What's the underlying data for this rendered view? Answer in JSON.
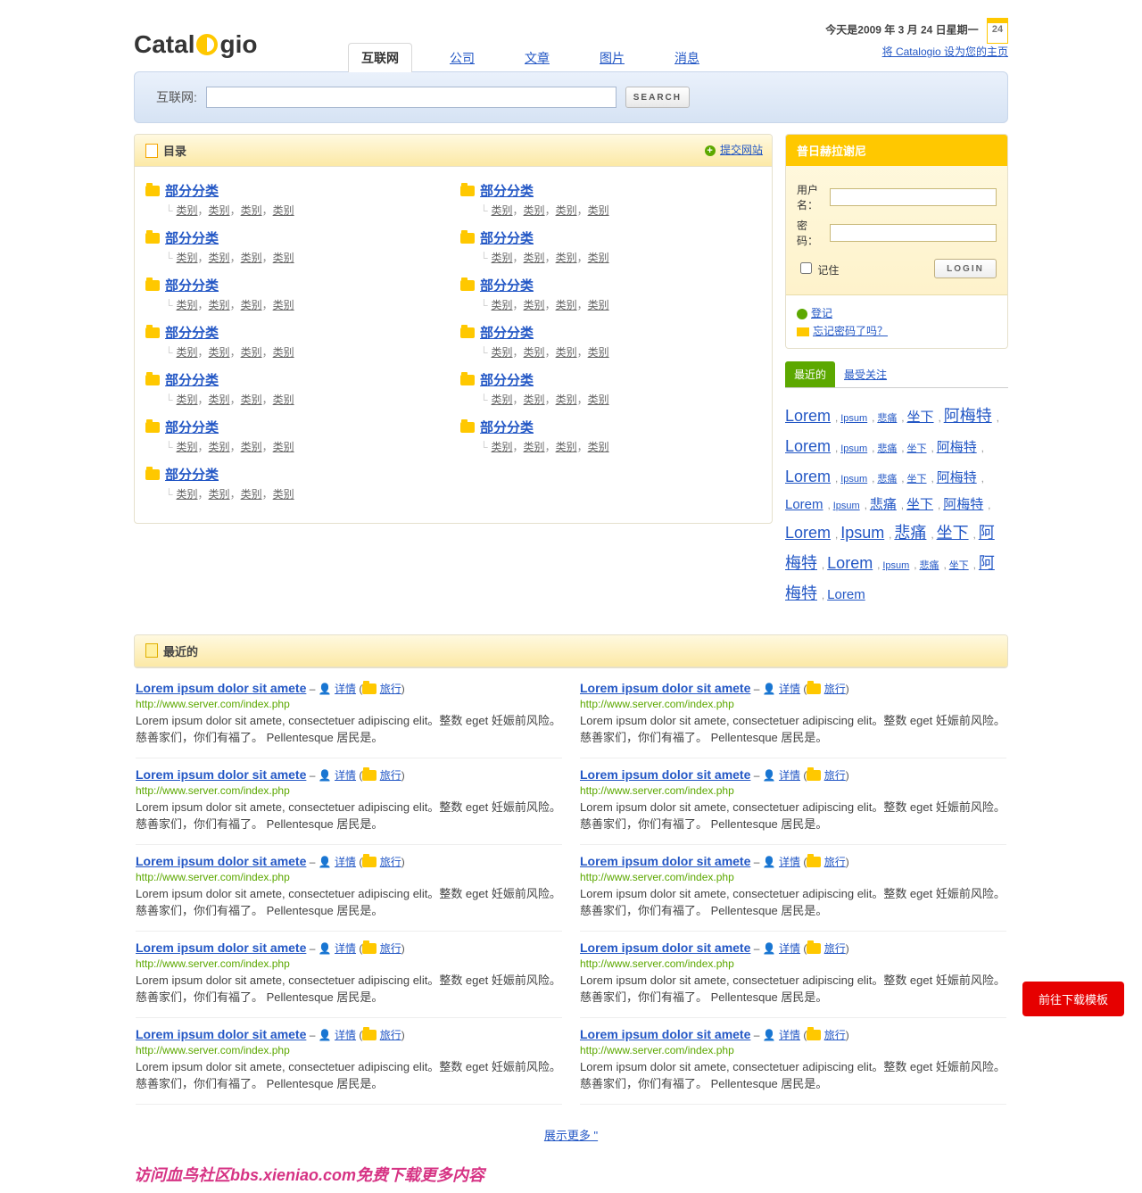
{
  "logo": {
    "pre": "Catal",
    "post": "gio"
  },
  "header": {
    "date": "今天是2009 年 3 月 24 日星期一",
    "homepage_link": "将 Catalogio 设为您的主页",
    "cal_day": "24"
  },
  "nav": [
    {
      "label": "互联网",
      "active": true
    },
    {
      "label": "公司",
      "active": false
    },
    {
      "label": "文章",
      "active": false
    },
    {
      "label": "图片",
      "active": false
    },
    {
      "label": "消息",
      "active": false
    }
  ],
  "search": {
    "label": "互联网:",
    "button": "SEARCH"
  },
  "catalog": {
    "title": "目录",
    "submit_link": "提交网站",
    "section": "部分分类",
    "sub": "类别",
    "left": [
      4,
      4,
      4,
      4,
      4,
      4,
      4
    ],
    "right": [
      4,
      4,
      4,
      4,
      4,
      4
    ]
  },
  "login": {
    "title": "普日赫拉谢尼",
    "username_label": "用户名：",
    "password_label": "密码：",
    "remember_label": "记住",
    "login_btn": "LOGIN",
    "register_link": "登记",
    "forgot_link": "忘记密码了吗？"
  },
  "tag_tabs": [
    {
      "label": "最近的",
      "active": true
    },
    {
      "label": "最受关注",
      "active": false
    }
  ],
  "tags": [
    {
      "t": "Lorem",
      "s": 1
    },
    {
      "t": "Ipsum",
      "s": 3
    },
    {
      "t": "悲痛",
      "s": 3
    },
    {
      "t": "坐下",
      "s": 2
    },
    {
      "t": "阿梅特",
      "s": 1
    },
    {
      "t": "Lorem",
      "s": 1
    },
    {
      "t": "Ipsum",
      "s": 3
    },
    {
      "t": "悲痛",
      "s": 3
    },
    {
      "t": "坐下",
      "s": 3
    },
    {
      "t": "阿梅特",
      "s": 2
    },
    {
      "t": "Lorem",
      "s": 1
    },
    {
      "t": "Ipsum",
      "s": 3
    },
    {
      "t": "悲痛",
      "s": 3
    },
    {
      "t": "坐下",
      "s": 3
    },
    {
      "t": "阿梅特",
      "s": 2
    },
    {
      "t": "Lorem",
      "s": 2
    },
    {
      "t": "Ipsum",
      "s": 3
    },
    {
      "t": "悲痛",
      "s": 2
    },
    {
      "t": "坐下",
      "s": 2
    },
    {
      "t": "阿梅特",
      "s": 2
    },
    {
      "t": "Lorem",
      "s": 1
    },
    {
      "t": "Ipsum",
      "s": 1
    },
    {
      "t": "悲痛",
      "s": 1
    },
    {
      "t": "坐下",
      "s": 1
    },
    {
      "t": "阿梅特",
      "s": 1
    },
    {
      "t": "Lorem",
      "s": 1
    },
    {
      "t": "Ipsum",
      "s": 3
    },
    {
      "t": "悲痛",
      "s": 3
    },
    {
      "t": "坐下",
      "s": 3
    },
    {
      "t": "阿梅特",
      "s": 1
    },
    {
      "t": "Lorem",
      "s": 2
    }
  ],
  "recent": {
    "title": "最近的",
    "item": {
      "title": "Lorem ipsum dolor sit amete",
      "details": "详情",
      "travel": "旅行",
      "url": "http://www.server.com/index.php",
      "desc": "Lorem ipsum dolor sit amete, consectetuer adipiscing elit。整数 eget 妊娠前风险。慈善家们，你们有福了。 Pellentesque 居民是。"
    },
    "left_count": 5,
    "right_count": 5,
    "show_more": "展示更多 \""
  },
  "watermark": "访问血鸟社区bbs.xieniao.com免费下载更多内容",
  "download_btn": "前往下载模板"
}
